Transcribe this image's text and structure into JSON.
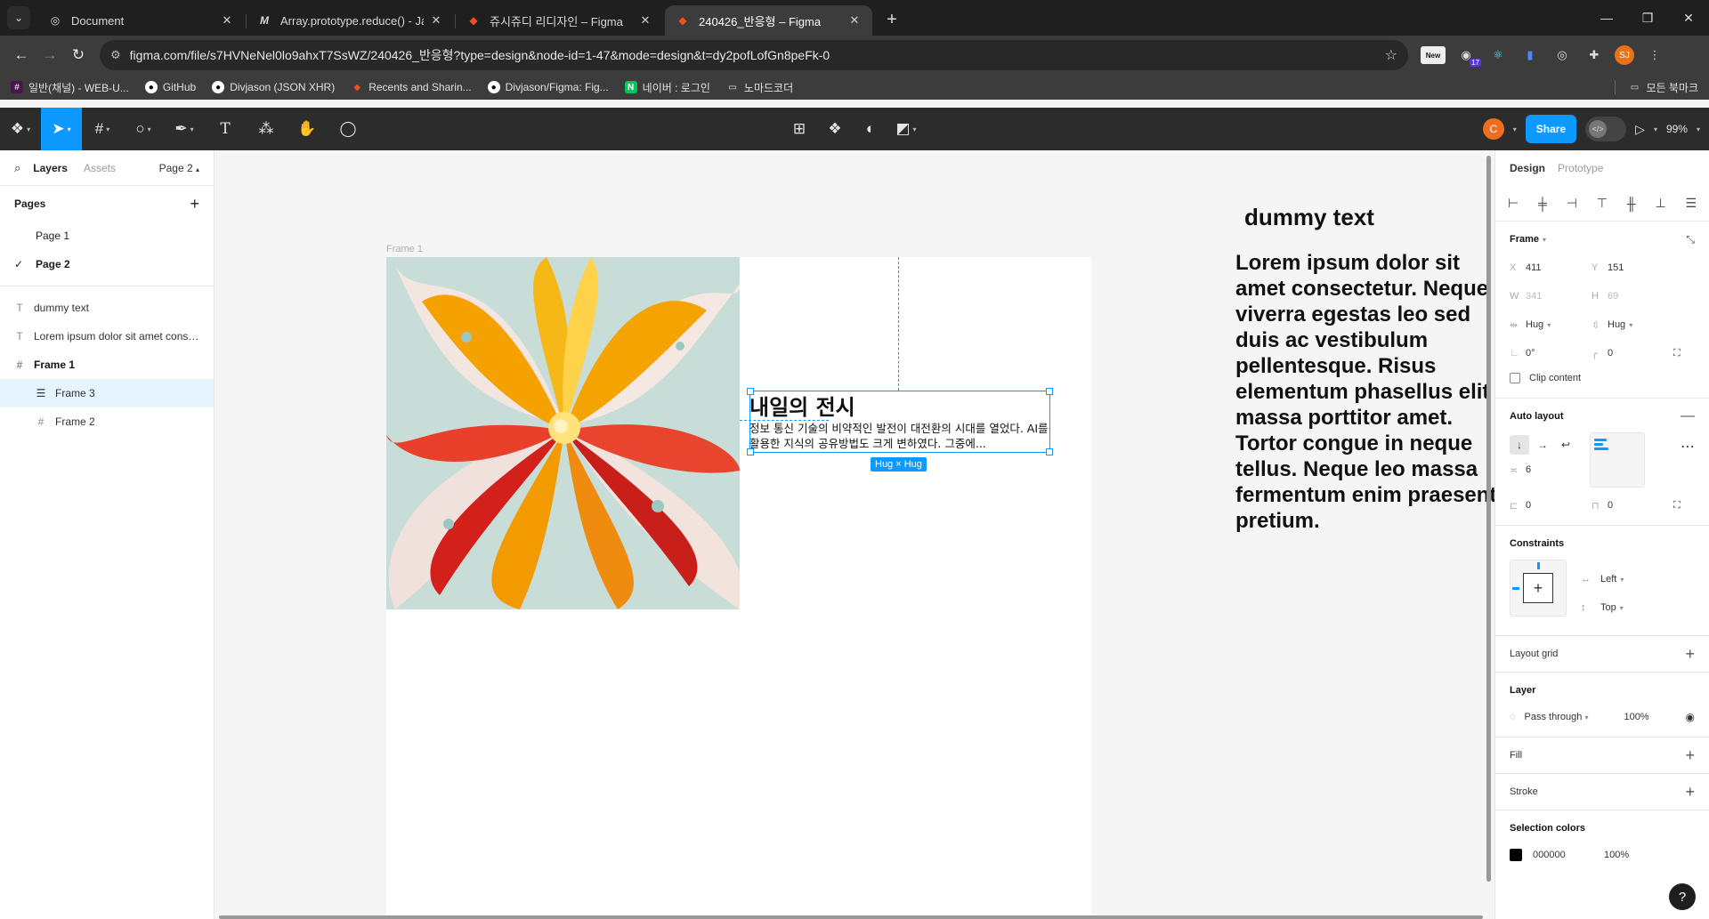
{
  "browser": {
    "tabs": [
      {
        "title": "Document",
        "icon": "globe-icon",
        "active": false
      },
      {
        "title": "Array.prototype.reduce() - JavaScript | MDN",
        "icon": "mdn-icon",
        "active": false
      },
      {
        "title": "쥬시쥬디 리디자인 – Figma",
        "icon": "figma-icon",
        "active": false
      },
      {
        "title": "240426_반응형 – Figma",
        "icon": "figma-icon",
        "active": true
      }
    ],
    "new_tab": "+",
    "url": "figma.com/file/s7HVNeNel0lo9ahxT7SsWZ/240426_반응형?type=design&node-id=1-47&mode=design&t=dy2pofLofGn8peFk-0",
    "extension_new_label": "New",
    "extension_badge": "17",
    "profile_initials": "SJ",
    "bookmarks": [
      {
        "label": "일반(채널) - WEB-U...",
        "icon": "slack-icon"
      },
      {
        "label": "GitHub",
        "icon": "github-icon"
      },
      {
        "label": "Divjason (JSON XHR)",
        "icon": "github-icon"
      },
      {
        "label": "Recents and Sharin...",
        "icon": "figma-icon"
      },
      {
        "label": "Divjason/Figma: Fig...",
        "icon": "github-icon"
      },
      {
        "label": "네이버 : 로그인",
        "icon": "naver-icon"
      },
      {
        "label": "노마드코더",
        "icon": "folder-icon"
      }
    ],
    "all_bookmarks": "모든 북마크"
  },
  "toolbar": {
    "avatar_initial": "C",
    "share_label": "Share",
    "zoom": "99%"
  },
  "left_panel": {
    "tab_layers": "Layers",
    "tab_assets": "Assets",
    "current_page": "Page 2",
    "pages_title": "Pages",
    "pages": [
      {
        "name": "Page 1",
        "current": false
      },
      {
        "name": "Page 2",
        "current": true
      }
    ],
    "layers": [
      {
        "name": "dummy text",
        "type": "text",
        "indent": 0
      },
      {
        "name": "Lorem ipsum dolor sit amet consectetur. Neque viverra",
        "type": "text",
        "indent": 0
      },
      {
        "name": "Frame 1",
        "type": "frame",
        "indent": 0
      },
      {
        "name": "Frame 3",
        "type": "autolayout",
        "indent": 1,
        "selected": true
      },
      {
        "name": "Frame 2",
        "type": "frame",
        "indent": 1
      }
    ]
  },
  "canvas": {
    "frame_label": "Frame 1",
    "selected_title": "내일의 전시",
    "selected_body": "정보 통신 기술의 비약적인 발전이 대전환의 시대를 열었다. AI를 활용한 지식의 공유방법도 크게 변하였다. 그중에...",
    "hug_badge": "Hug × Hug",
    "dummy_title": "dummy text",
    "lorem": "Lorem ipsum dolor sit amet consectetur. Neque viverra egestas leo sed duis ac vestibulum pellentesque. Risus elementum phasellus elit massa porttitor amet. Tortor congue in neque tellus. Neque leo massa fermentum enim praesent pretium."
  },
  "right_panel": {
    "tab_design": "Design",
    "tab_prototype": "Prototype",
    "frame_title": "Frame",
    "x_label": "X",
    "x": "411",
    "y_label": "Y",
    "y": "151",
    "w_label": "W",
    "w": "341",
    "h_label": "H",
    "h": "69",
    "hug_w": "Hug",
    "hug_h": "Hug",
    "rotation": "0°",
    "radius": "0",
    "clip_content": "Clip content",
    "auto_layout_title": "Auto layout",
    "gap": "6",
    "padding_h": "0",
    "padding_v": "0",
    "constraints_title": "Constraints",
    "constraint_h": "Left",
    "constraint_v": "Top",
    "layout_grid": "Layout grid",
    "layer_title": "Layer",
    "blend": "Pass through",
    "opacity": "100%",
    "fill": "Fill",
    "stroke": "Stroke",
    "selection_colors": "Selection colors",
    "sel_color_hex": "000000",
    "sel_color_opacity": "100%"
  },
  "help": "?"
}
